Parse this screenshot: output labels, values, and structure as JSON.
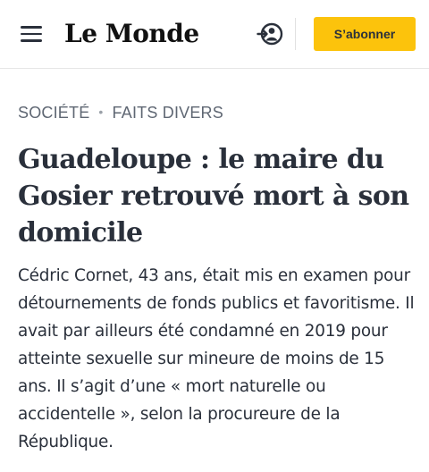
{
  "header": {
    "menu_icon": "hamburger-menu-icon",
    "logo_text": "Le Monde",
    "account_icon": "login-account-icon",
    "subscribe_label": "S’abonner",
    "subscribe_color": "#fcc30c"
  },
  "breadcrumb": {
    "section": "SOCIÉTÉ",
    "separator": "•",
    "subsection": "FAITS DIVERS"
  },
  "article": {
    "title": "Guadeloupe : le maire du Gosier retrouvé mort à son domicile",
    "lead": "Cédric Cornet, 43 ans, était mis en examen pour détournements de fonds publics et favoritisme. Il avait par ailleurs été condamné en 2019 pour atteinte sexuelle sur mineure de moins de 15 ans. Il s’agit d’une « mort naturelle ou accidentelle », selon la procureure de la République."
  }
}
